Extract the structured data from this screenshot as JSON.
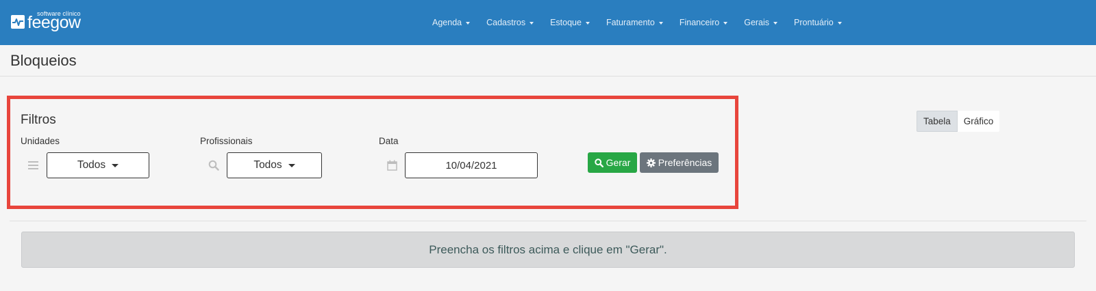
{
  "brand": {
    "name": "feegow",
    "tagline": "software clínico"
  },
  "nav": {
    "items": [
      {
        "label": "Agenda",
        "name": "nav-agenda"
      },
      {
        "label": "Cadastros",
        "name": "nav-cadastros"
      },
      {
        "label": "Estoque",
        "name": "nav-estoque"
      },
      {
        "label": "Faturamento",
        "name": "nav-faturamento"
      },
      {
        "label": "Financeiro",
        "name": "nav-financeiro"
      },
      {
        "label": "Gerais",
        "name": "nav-gerais"
      },
      {
        "label": "Prontuário",
        "name": "nav-prontuario"
      }
    ]
  },
  "page": {
    "title": "Bloqueios"
  },
  "filters": {
    "title": "Filtros",
    "unidades": {
      "label": "Unidades",
      "value": "Todos",
      "icon": "list-icon"
    },
    "profissionais": {
      "label": "Profissionais",
      "value": "Todos",
      "icon": "search-icon"
    },
    "data": {
      "label": "Data",
      "value": "10/04/2021",
      "icon": "calendar-icon"
    },
    "gerar_label": "Gerar",
    "preferencias_label": "Preferências"
  },
  "view_toggle": {
    "tabela_label": "Tabela",
    "grafico_label": "Gráfico",
    "selected": "Tabela"
  },
  "alert": {
    "message": "Preencha os filtros acima e clique em \"Gerar\"."
  },
  "colors": {
    "navbar": "#2a7ebf",
    "highlight_border": "#e8453c",
    "button_success": "#28a745",
    "button_secondary": "#6c757d",
    "alert_bg": "#d8d9da"
  }
}
